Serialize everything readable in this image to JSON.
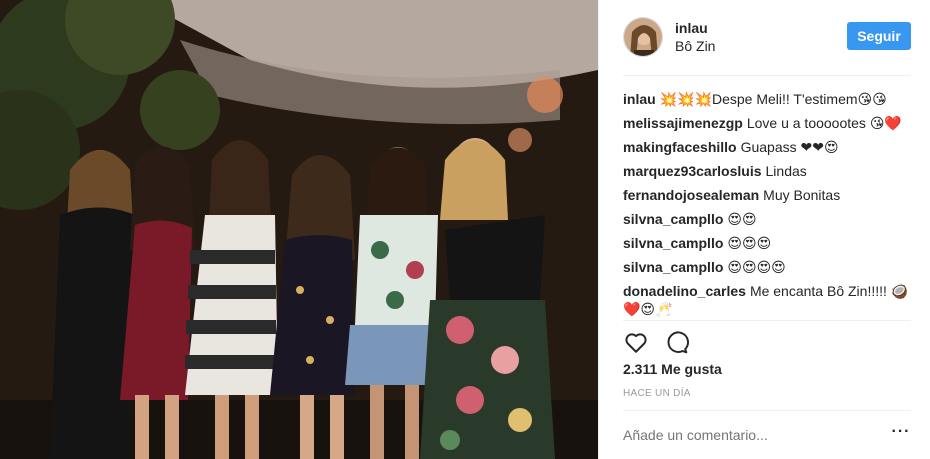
{
  "post": {
    "image_alt": "Group of six women posing at night venue"
  },
  "header": {
    "username": "inlau",
    "location": "Bô Zin",
    "follow_label": "Seguir"
  },
  "comments": [
    {
      "user": "inlau",
      "text": "💥💥💥Despe Meli!! T'estimem😘😘"
    },
    {
      "user": "melissajimenezgp",
      "text": "Love u a toooootes 😘❤️"
    },
    {
      "user": "makingfaceshillo",
      "text": "Guapass ❤❤😍"
    },
    {
      "user": "marquez93carlosluis",
      "text": "Lindas"
    },
    {
      "user": "fernandojosealeman",
      "text": "Muy Bonitas"
    },
    {
      "user": "silvna_campllo",
      "text": "😍😍"
    },
    {
      "user": "silvna_campllo",
      "text": "😍😍😍"
    },
    {
      "user": "silvna_campllo",
      "text": "😍😍😍😍"
    },
    {
      "user": "donadelino_carles",
      "text": "Me encanta Bô Zin!!!!! 🥥❤️😍🥂"
    }
  ],
  "actions": {
    "like_icon": "heart-icon",
    "comment_icon": "comment-icon"
  },
  "likes": "2.311 Me gusta",
  "time": "HACE UN DÍA",
  "comment_box": {
    "placeholder": "Añade un comentario...",
    "more_icon": "more-options-icon"
  }
}
